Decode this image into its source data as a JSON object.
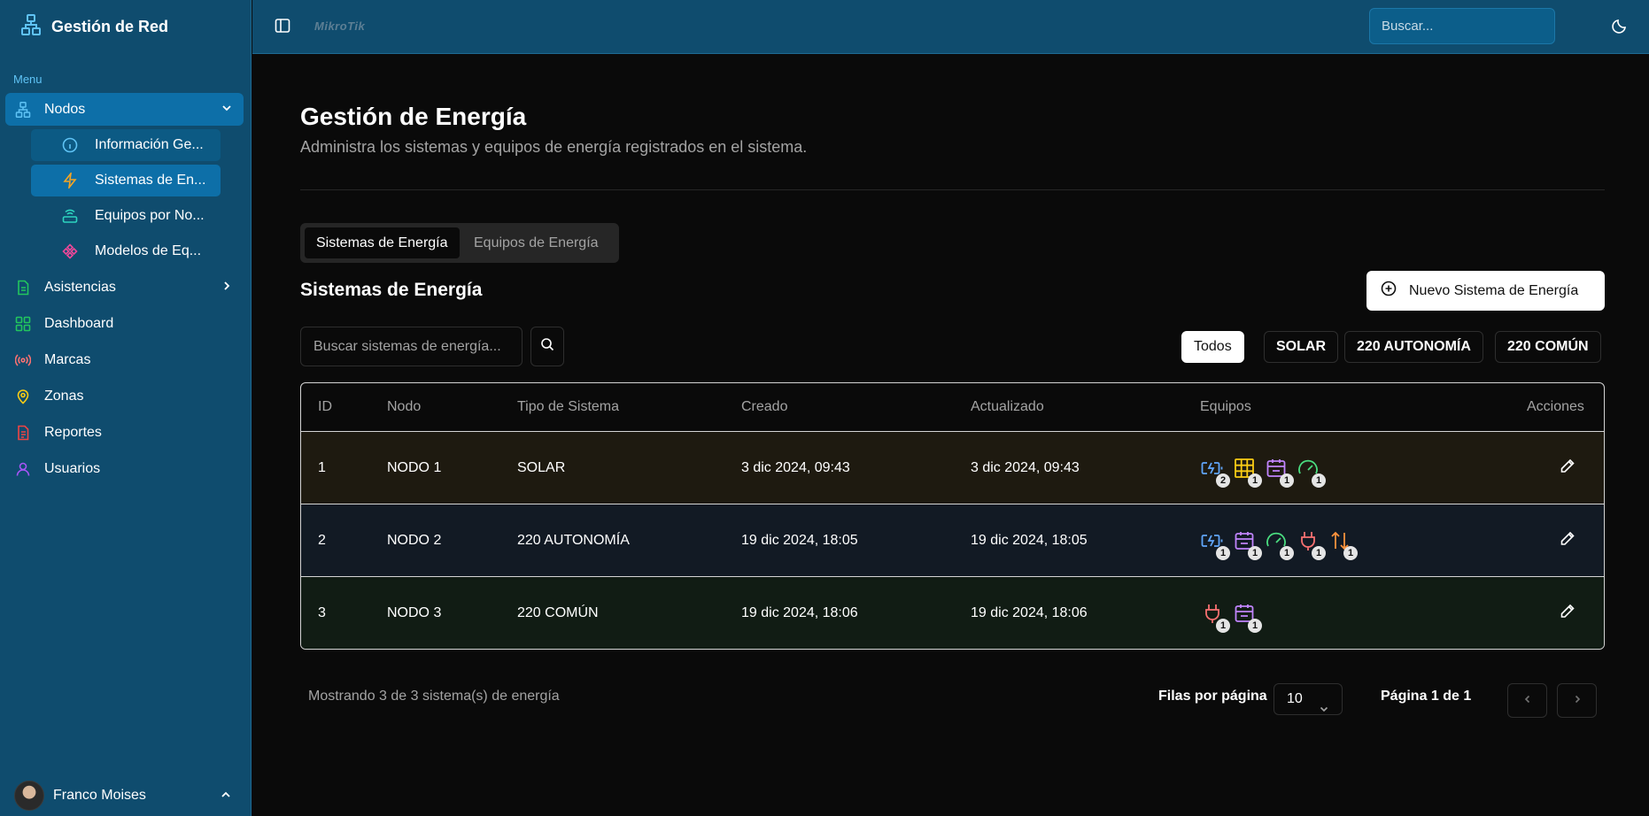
{
  "app": {
    "title": "Gestión de Red"
  },
  "sidebar": {
    "menu_label": "Menu",
    "nodos": "Nodos",
    "sub_items": [
      "Información Ge...",
      "Sistemas de En...",
      "Equipos por No...",
      "Modelos de Eq..."
    ],
    "items": [
      "Asistencias",
      "Dashboard",
      "Marcas",
      "Zonas",
      "Reportes",
      "Usuarios"
    ],
    "user_name": "Franco Moises"
  },
  "topbar": {
    "logo": "MikroTik",
    "search_placeholder": "Buscar..."
  },
  "page": {
    "title": "Gestión de Energía",
    "subtitle": "Administra los sistemas y equipos de energía registrados en el sistema.",
    "tabs": [
      "Sistemas de Energía",
      "Equipos de Energía"
    ],
    "section_title": "Sistemas de Energía",
    "new_button": "Nuevo Sistema de Energía",
    "search_placeholder": "Buscar sistemas de energía...",
    "filters": [
      "Todos",
      "SOLAR",
      "220 AUTONOMÍA",
      "220 COMÚN"
    ]
  },
  "table": {
    "headers": [
      "ID",
      "Nodo",
      "Tipo de Sistema",
      "Creado",
      "Actualizado",
      "Equipos",
      "Acciones"
    ],
    "rows": [
      {
        "id": "1",
        "nodo": "NODO 1",
        "tipo": "SOLAR",
        "creado": "3 dic 2024, 09:43",
        "actualizado": "3 dic 2024, 09:43",
        "equipos": [
          {
            "icon": "battery-charging-icon",
            "count": "2"
          },
          {
            "icon": "solar-panel-icon",
            "count": "1"
          },
          {
            "icon": "calendar-device-icon",
            "count": "1"
          },
          {
            "icon": "gauge-icon",
            "count": "1"
          }
        ]
      },
      {
        "id": "2",
        "nodo": "NODO 2",
        "tipo": "220 AUTONOMÍA",
        "creado": "19 dic 2024, 18:05",
        "actualizado": "19 dic 2024, 18:05",
        "equipos": [
          {
            "icon": "battery-charging-icon",
            "count": "1"
          },
          {
            "icon": "calendar-device-icon",
            "count": "1"
          },
          {
            "icon": "gauge-icon",
            "count": "1"
          },
          {
            "icon": "plug-icon",
            "count": "1"
          },
          {
            "icon": "arrows-up-down-icon",
            "count": "1"
          }
        ]
      },
      {
        "id": "3",
        "nodo": "NODO 3",
        "tipo": "220 COMÚN",
        "creado": "19 dic 2024, 18:06",
        "actualizado": "19 dic 2024, 18:06",
        "equipos": [
          {
            "icon": "plug-icon",
            "count": "1"
          },
          {
            "icon": "calendar-device-icon",
            "count": "1"
          }
        ]
      }
    ]
  },
  "footer": {
    "showing": "Mostrando 3 de 3 sistema(s) de energía",
    "rows_label": "Filas por página",
    "rows_value": "10",
    "page_info": "Página 1 de 1"
  },
  "colors": {
    "sidebar_bg": "#0f4c6e",
    "active_item": "#0d6fa8",
    "battery": "#60a5fa",
    "solar": "#facc15",
    "device": "#c084fc",
    "gauge": "#4ade80",
    "plug": "#f87171",
    "arrows": "#fb923c"
  }
}
